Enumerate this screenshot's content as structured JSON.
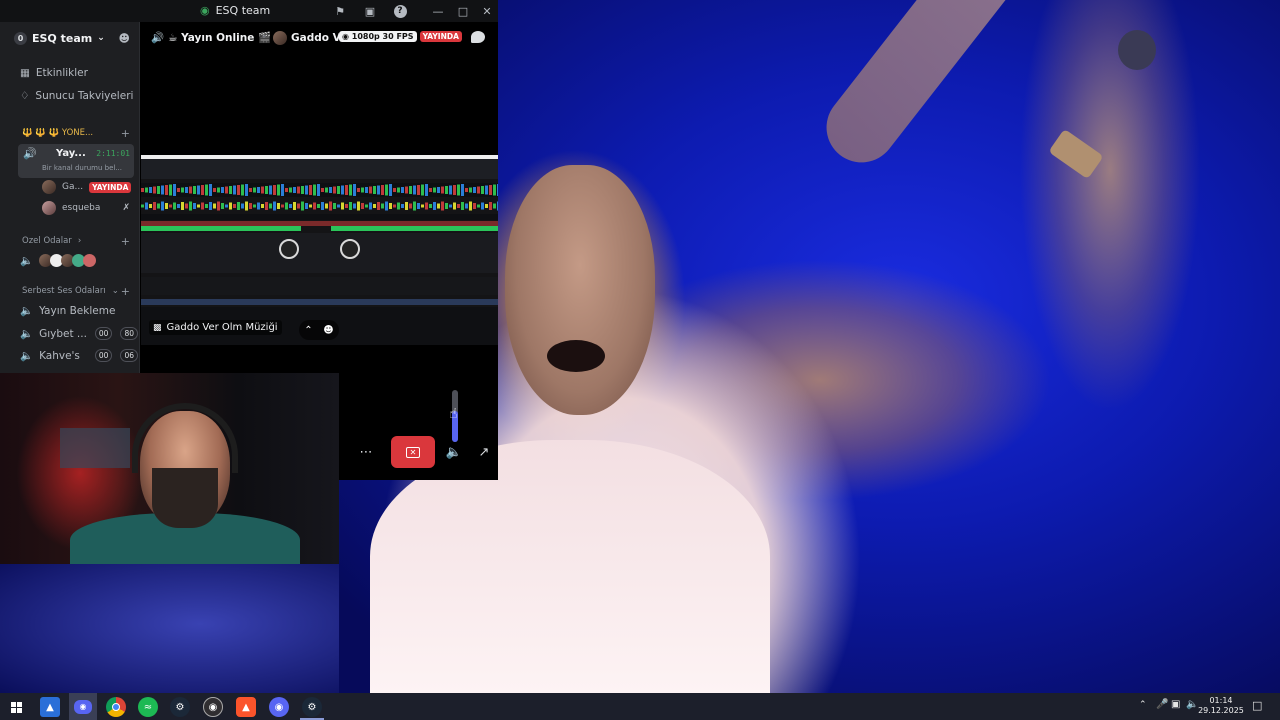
{
  "window": {
    "title": "ESQ team",
    "title_icon": "discord-logo-icon",
    "buttons": [
      "flag-icon",
      "screen-icon",
      "help-icon",
      "minimize-icon",
      "maximize-icon",
      "close-icon"
    ]
  },
  "server": {
    "count_badge": "0",
    "name": "ESQ team",
    "chevron": "chevron-down-icon",
    "invite_icon": "add-member-icon"
  },
  "sidebar": {
    "events": "Etkinlikler",
    "boosts": "Sunucu Takviyeleri",
    "category_admin": "🔱 🔱 🔱 YÖNE...",
    "active_channel": {
      "name": "Yay...",
      "timer": "2:11:01",
      "status": "Bir kanal durumu bel..."
    },
    "members": [
      {
        "name": "Ga...",
        "badge": "YAYINDA"
      },
      {
        "name": "esqueba",
        "badge": ""
      }
    ],
    "category_private": "Özel Odalar",
    "category_free": "Serbest Ses Odaları",
    "voice_channels": [
      {
        "name": "Yayın Bekleme",
        "a": "",
        "b": ""
      },
      {
        "name": "Gıybet ...",
        "a": "00",
        "b": "80"
      },
      {
        "name": "Kahve's",
        "a": "00",
        "b": "06"
      }
    ]
  },
  "stream": {
    "channel": "☕ Yayın Online 🎬",
    "streamer": "Gaddo Ve",
    "quality": "1080p 30 FPS",
    "live": "YAYINDA",
    "label": "Gaddo Ver Olm Müziği",
    "volume_fraction": 0.6
  },
  "taskbar": {
    "apps": [
      "windows-start-icon",
      "explorer-icon",
      "discord-icon",
      "chrome-icon",
      "spotify-icon",
      "steam-icon",
      "obs-icon",
      "brave-icon",
      "discord-ptb-icon",
      "steam-alt-icon"
    ],
    "time": "01:14",
    "date": "29.12.2025"
  }
}
